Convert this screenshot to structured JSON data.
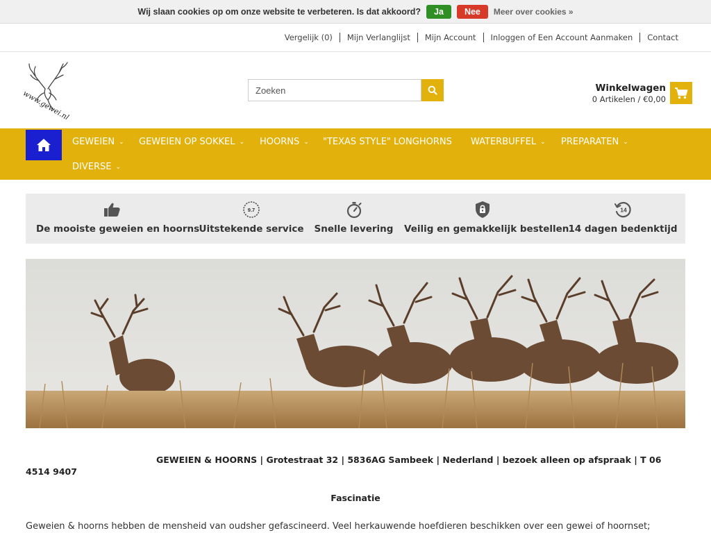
{
  "cookie_bar": {
    "message": "Wij slaan cookies op om onze website te verbeteren. Is dat akkoord?",
    "accept_label": "Ja",
    "decline_label": "Nee",
    "more_label": "Meer over cookies »"
  },
  "top_links": {
    "compare": "Vergelijk (0)",
    "wishlist": "Mijn Verlanglijst",
    "account": "Mijn Account",
    "login": "Inloggen of Een Account Aanmaken",
    "contact": "Contact"
  },
  "logo": {
    "text": "www.gewei.nl"
  },
  "search": {
    "placeholder": "Zoeken"
  },
  "cart": {
    "title": "Winkelwagen",
    "summary": "0 Artikelen / €0,00"
  },
  "nav": {
    "items": [
      {
        "label": "GEWEIEN",
        "has_dropdown": true
      },
      {
        "label": "GEWEIEN OP SOKKEL",
        "has_dropdown": true
      },
      {
        "label": "HOORNS",
        "has_dropdown": true
      },
      {
        "label": "\"TEXAS STYLE\" LONGHORNS",
        "has_dropdown": false
      },
      {
        "label": "WATERBUFFEL",
        "has_dropdown": true
      },
      {
        "label": "PREPARATEN",
        "has_dropdown": true
      },
      {
        "label": "DIVERSE",
        "has_dropdown": true
      }
    ]
  },
  "usp": [
    {
      "icon": "thumbs-up-icon",
      "label": "De mooiste geweien en hoorns"
    },
    {
      "icon": "rating-badge-icon",
      "badge": "9.7",
      "label": "Uitstekende service"
    },
    {
      "icon": "stopwatch-icon",
      "label": "Snelle levering"
    },
    {
      "icon": "shield-lock-icon",
      "label": "Veilig en gemakkelijk bestellen"
    },
    {
      "icon": "return-14-icon",
      "badge": "14",
      "label": "14 dagen bedenktijd"
    }
  ],
  "content": {
    "address": "GEWEIEN & HOORNS | Grotestraat 32 | 5836AG Sambeek | Nederland | bezoek alleen op afspraak | T 06 4514 9407",
    "section_title": "Fascinatie",
    "intro": "Geweien & hoorns hebben de mensheid van oudsher gefascineerd. Veel herkauwende hoefdieren beschikken over een gewei of hoornset;"
  },
  "colors": {
    "accent": "#e3b10b",
    "home_button": "#1a1fd0",
    "accept": "#2f8f25",
    "decline": "#d73a28"
  }
}
